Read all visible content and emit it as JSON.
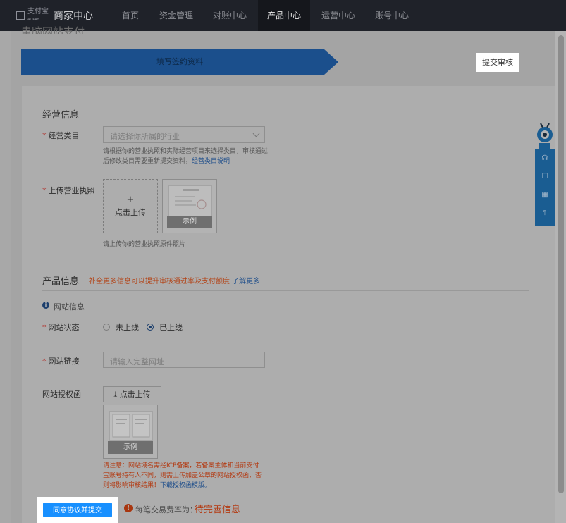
{
  "brand": {
    "logo_text": "支付宝",
    "logo_sub": "ALIPAY",
    "title": "商家中心"
  },
  "nav": [
    "首页",
    "资金管理",
    "对账中心",
    "产品中心",
    "运营中心",
    "账号中心"
  ],
  "nav_active": "产品中心",
  "page_title": "电脑网站支付",
  "steps": [
    "填写签约资料",
    "提交审核"
  ],
  "business": {
    "title": "经营信息",
    "category_label": "经营类目",
    "category_placeholder": "请选择你所属的行业",
    "category_hint": "请根据你的营业执照和实际经营项目来选择类目，审核通过后修改类目需要重新提交资料，",
    "category_hint_link": "经营类目说明",
    "license_label": "上传营业执照",
    "upload_text": "点击上传",
    "sample_text": "示例",
    "license_hint": "请上传你的营业执照原件照片"
  },
  "product": {
    "title": "产品信息",
    "tip": "补全更多信息可以提升审核通过率及支付额度",
    "tip_link": "了解更多",
    "website_info": "网站信息",
    "status_label": "网站状态",
    "status_options": [
      "未上线",
      "已上线"
    ],
    "status_selected": "已上线",
    "link_label": "网站链接",
    "link_placeholder": "请输入完整网址",
    "auth_label": "网站授权函",
    "auth_upload": "点击上传",
    "sample_text": "示例",
    "notice": "请注意：网站域名需经ICP备案，若备案主体和当前支付宝账号持有人不同，则需上传加盖公章的网站授权函，否则将影响审核结果！",
    "notice_link": "下载授权函模版。"
  },
  "footer": {
    "submit": "同意协议并提交",
    "fee_label": "每笔交易费率为：",
    "fee_value": "待完善信息"
  }
}
